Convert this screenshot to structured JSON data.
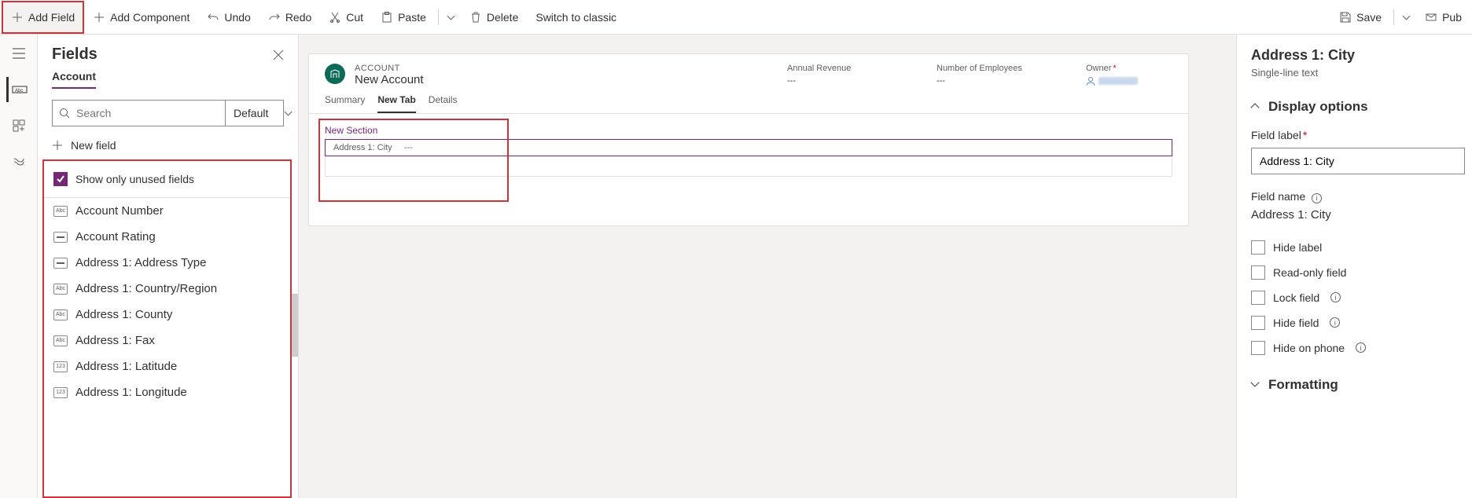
{
  "cmdbar": {
    "add_field": "Add Field",
    "add_component": "Add Component",
    "undo": "Undo",
    "redo": "Redo",
    "cut": "Cut",
    "paste": "Paste",
    "delete": "Delete",
    "switch": "Switch to classic",
    "save": "Save",
    "publish": "Pub"
  },
  "panel": {
    "title": "Fields",
    "entity": "Account",
    "search_placeholder": "Search",
    "filter": "Default",
    "new_field": "New field",
    "show_unused": "Show only unused fields",
    "items": [
      {
        "type": "Abc",
        "label": "Account Number"
      },
      {
        "type": "opt",
        "label": "Account Rating"
      },
      {
        "type": "opt",
        "label": "Address 1: Address Type"
      },
      {
        "type": "Abc",
        "label": "Address 1: Country/Region"
      },
      {
        "type": "Abc",
        "label": "Address 1: County"
      },
      {
        "type": "Abc",
        "label": "Address 1: Fax"
      },
      {
        "type": "123",
        "label": "Address 1: Latitude"
      },
      {
        "type": "123",
        "label": "Address 1: Longitude"
      }
    ]
  },
  "form": {
    "entity_upper": "ACCOUNT",
    "entity_name": "New Account",
    "header_fields": [
      {
        "label": "Annual Revenue",
        "value": "---"
      },
      {
        "label": "Number of Employees",
        "value": "---"
      },
      {
        "label": "Owner",
        "value": ""
      }
    ],
    "tabs": [
      "Summary",
      "New Tab",
      "Details"
    ],
    "active_tab": 1,
    "section_title": "New Section",
    "field_label": "Address 1: City",
    "field_value": "---"
  },
  "props": {
    "title": "Address 1: City",
    "subtitle": "Single-line text",
    "display_options": "Display options",
    "field_label_lbl": "Field label",
    "field_label_val": "Address 1: City",
    "field_name_lbl": "Field name",
    "field_name_val": "Address 1: City",
    "hide_label": "Hide label",
    "read_only": "Read-only field",
    "lock_field": "Lock field",
    "hide_field": "Hide field",
    "hide_phone": "Hide on phone",
    "formatting": "Formatting"
  }
}
